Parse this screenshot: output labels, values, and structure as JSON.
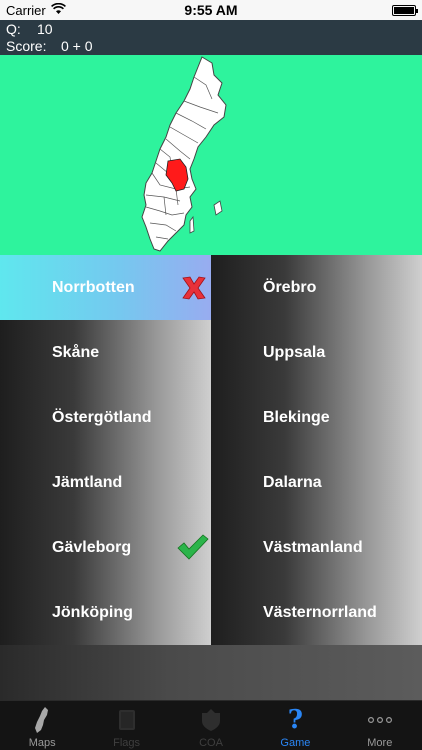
{
  "status_bar": {
    "carrier": "Carrier",
    "time": "9:55 AM"
  },
  "info": {
    "q_label": "Q:",
    "q_value": "10",
    "score_label": "Score:",
    "score_value": "0 + 0"
  },
  "map": {
    "background": "#2ef39d",
    "highlight_color": "#ff1a1a"
  },
  "answers": {
    "left": [
      {
        "label": "Norrbotten",
        "state": "wrong"
      },
      {
        "label": "Skåne",
        "state": ""
      },
      {
        "label": "Östergötland",
        "state": ""
      },
      {
        "label": "Jämtland",
        "state": ""
      },
      {
        "label": "Gävleborg",
        "state": "correct"
      },
      {
        "label": "Jönköping",
        "state": ""
      }
    ],
    "right": [
      {
        "label": "Örebro"
      },
      {
        "label": "Uppsala"
      },
      {
        "label": "Blekinge"
      },
      {
        "label": "Dalarna"
      },
      {
        "label": "Västmanland"
      },
      {
        "label": "Västernorrland"
      }
    ]
  },
  "tabs": [
    {
      "label": "Maps",
      "icon": "sweden-map-icon",
      "state": "normal"
    },
    {
      "label": "Flags",
      "icon": "flag-icon",
      "state": "dim"
    },
    {
      "label": "COA",
      "icon": "coat-of-arms-icon",
      "state": "dim"
    },
    {
      "label": "Game",
      "icon": "question-mark-icon",
      "state": "active"
    },
    {
      "label": "More",
      "icon": "more-dots-icon",
      "state": "normal"
    }
  ],
  "colors": {
    "accent": "#2a86f5",
    "header": "#2b3a44",
    "wrong_mark": "#e8313a",
    "correct_mark": "#2bb44a"
  }
}
